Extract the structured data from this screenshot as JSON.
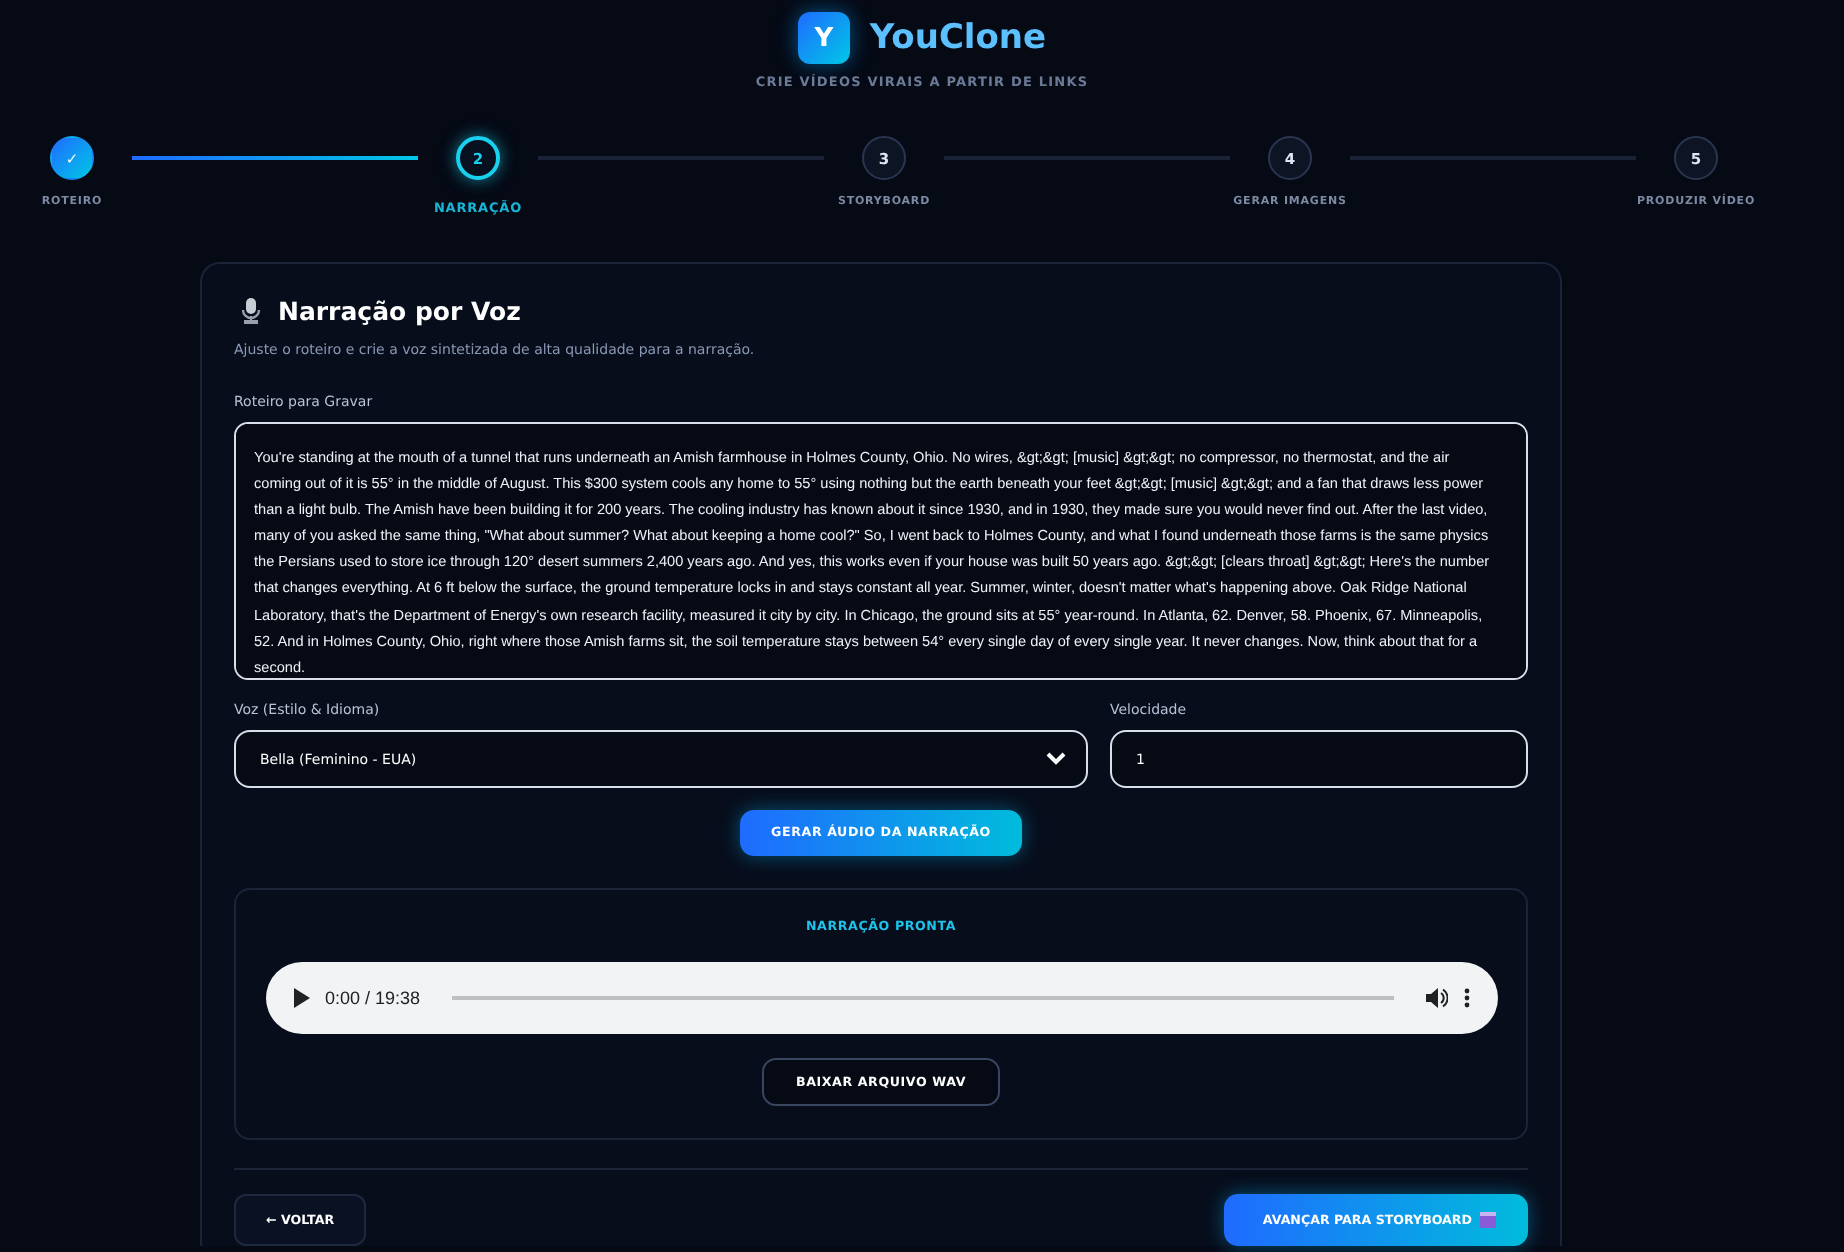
{
  "header": {
    "logo_letter": "Y",
    "title": "YouClone",
    "subtitle": "CRIE VÍDEOS VIRAIS A PARTIR DE LINKS"
  },
  "steps": [
    {
      "marker": "✓",
      "label": "ROTEIRO",
      "completed": true,
      "selected": false
    },
    {
      "marker": "2",
      "label": "NARRAÇÃO",
      "completed": false,
      "selected": true
    },
    {
      "marker": "3",
      "label": "STORYBOARD",
      "completed": false,
      "selected": false
    },
    {
      "marker": "4",
      "label": "GERAR IMAGENS",
      "completed": false,
      "selected": false
    },
    {
      "marker": "5",
      "label": "PRODUZIR VÍDEO",
      "completed": false,
      "selected": false
    }
  ],
  "card": {
    "title": "Narração por Voz",
    "description": "Ajuste o roteiro e crie a voz sintetizada de alta qualidade para a narração.",
    "script_label": "Roteiro para Gravar",
    "script_value": "You're standing at the mouth of a tunnel that runs underneath an Amish farmhouse in Holmes County, Ohio. No wires, &gt;&gt; [music] &gt;&gt; no compressor, no thermostat, and the air coming out of it is 55° in the middle of August. This $300 system cools any home to 55° using nothing but the earth beneath your feet &gt;&gt; [music] &gt;&gt; and a fan that draws less power than a light bulb. The Amish have been building it for 200 years. The cooling industry has known about it since 1930, and in 1930, they made sure you would never find out. After the last video, many of you asked the same thing, \"What about summer? What about keeping a home cool?\" So, I went back to Holmes County, and what I found underneath those farms is the same physics the Persians used to store ice through 120° desert summers 2,400 years ago. And yes, this works even if your house was built 50 years ago. &gt;&gt; [clears throat] &gt;&gt; Here's the number that changes everything. At 6 ft below the surface, the ground temperature locks in and stays constant all year. Summer, winter, doesn't matter what's happening above. Oak Ridge National Laboratory, that's the Department of Energy's own research facility, measured it city by city. In Chicago, the ground sits at 55° year-round. In Atlanta, 62. Denver, 58. Phoenix, 67. Minneapolis, 52. And in Holmes County, Ohio, right where those Amish farms sit, the soil temperature stays between 54° every single day of every single year. It never changes. Now, think about that for a second.",
    "voice_label": "Voz (Estilo & Idioma)",
    "voice_value": "Bella (Feminino - EUA)",
    "speed_label": "Velocidade",
    "speed_value": "1",
    "generate_button": "GERAR ÁUDIO DA NARRAÇÃO",
    "ready": {
      "title": "NARRAÇÃO PRONTA",
      "player": {
        "time": "0:00 / 19:38",
        "level": 0
      },
      "download_button": "BAIXAR ARQUIVO WAV"
    },
    "back_button": "← VOLTAR",
    "next_button": "AVANÇAR PARA STORYBOARD"
  }
}
